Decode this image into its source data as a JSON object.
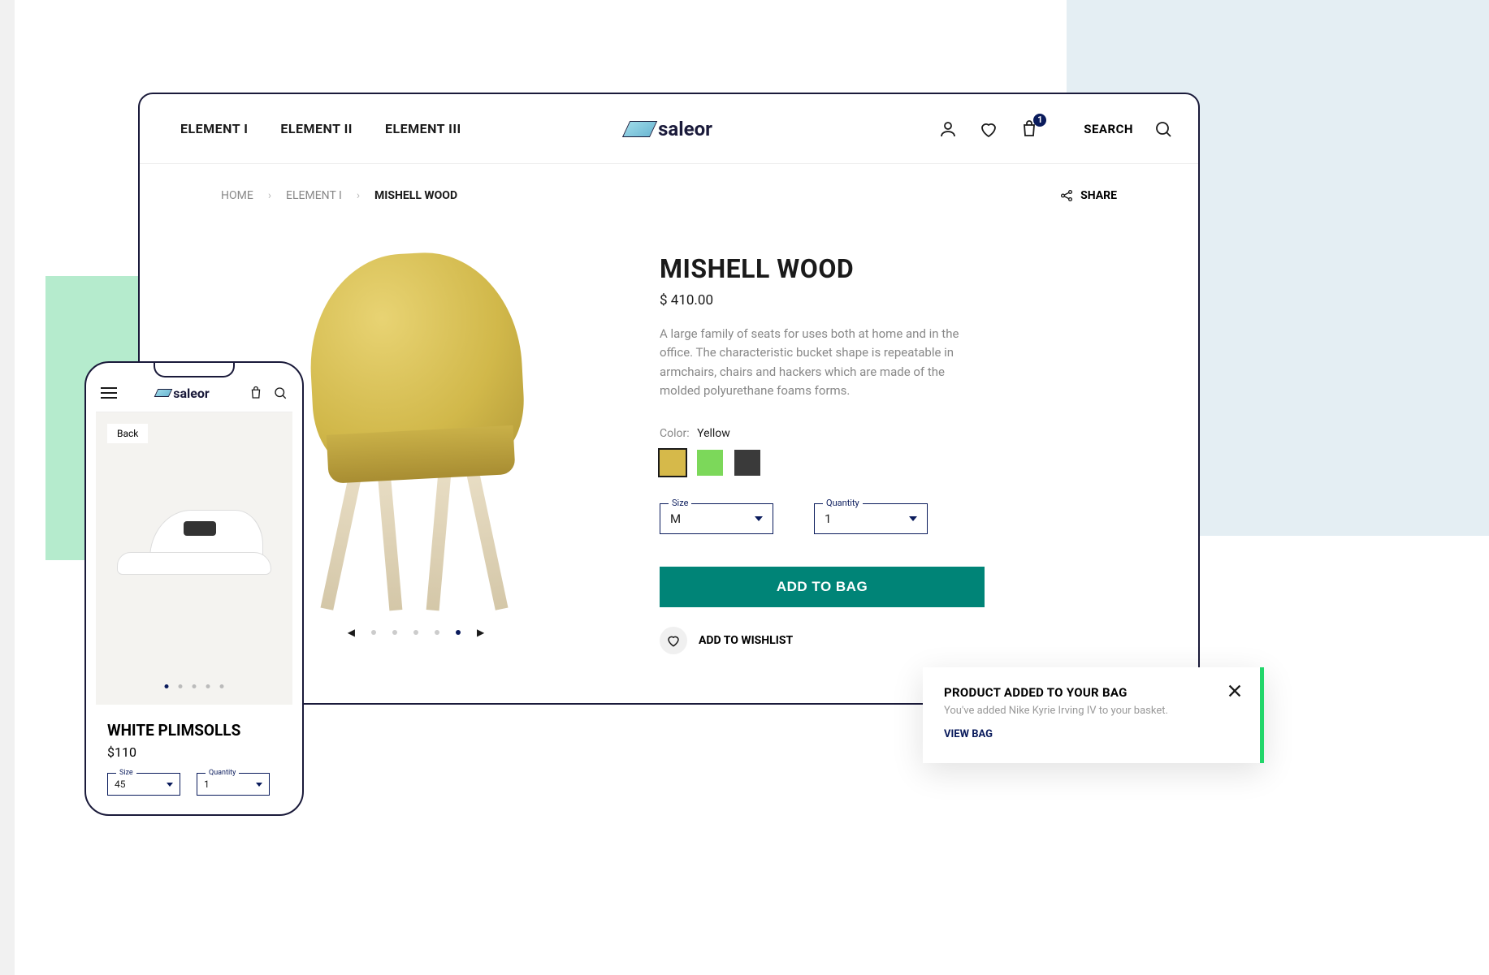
{
  "nav": {
    "items": [
      "ELEMENT I",
      "ELEMENT II",
      "ELEMENT III"
    ]
  },
  "logo_text": "saleor",
  "header": {
    "search_label": "SEARCH",
    "cart_count": "1"
  },
  "breadcrumb": {
    "home": "HOME",
    "category": "ELEMENT I",
    "current": "MISHELL WOOD"
  },
  "share_label": "SHARE",
  "product": {
    "title": "MISHELL WOOD",
    "price": "$ 410.00",
    "description": "A large family of seats for uses both at home and in the office. The characteristic bucket shape is repeatable in armchairs, chairs and hackers which are made of the molded polyurethane foams forms.",
    "color_label": "Color:",
    "color_value": "Yellow",
    "swatches": [
      {
        "hex": "#d6b94a",
        "selected": true
      },
      {
        "hex": "#7cd85a",
        "selected": false
      },
      {
        "hex": "#3a3a3a",
        "selected": false
      }
    ],
    "size_label": "Size",
    "size_value": "M",
    "qty_label": "Quantity",
    "qty_value": "1",
    "add_to_bag": "ADD TO BAG",
    "wishlist_label": "ADD TO WISHLIST"
  },
  "mobile": {
    "back_label": "Back",
    "title": "WHITE PLIMSOLLS",
    "price": "$110",
    "size_label": "Size",
    "size_value": "45",
    "qty_label": "Quantity",
    "qty_value": "1"
  },
  "toast": {
    "title": "PRODUCT ADDED TO YOUR BAG",
    "message": "You've added Nike Kyrie Irving IV to your basket.",
    "link": "VIEW BAG"
  }
}
